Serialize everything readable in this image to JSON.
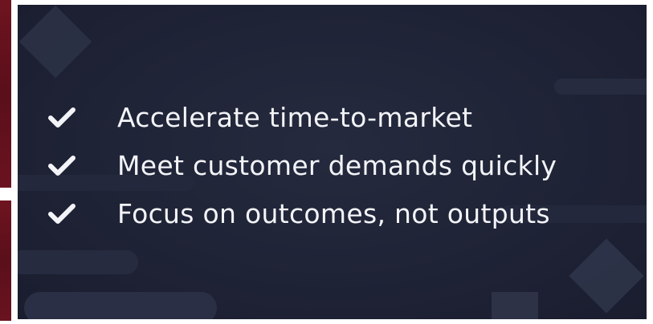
{
  "slide": {
    "bullets": [
      {
        "text": "Accelerate time-to-market",
        "icon": "check-icon"
      },
      {
        "text": "Meet customer demands quickly",
        "icon": "check-icon"
      },
      {
        "text": "Focus on outcomes, not outputs",
        "icon": "check-icon"
      }
    ]
  },
  "colors": {
    "background": "#1f2336",
    "text": "#f3f4f8",
    "accent_strip": "#6e1420"
  }
}
